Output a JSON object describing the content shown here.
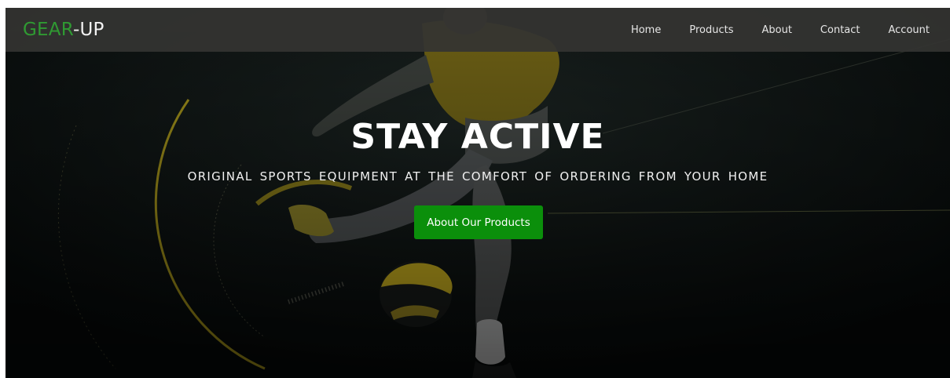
{
  "brand": {
    "part1": "GEAR",
    "part2": "-UP",
    "colors": {
      "accent": "#2f9a32",
      "text": "#f2f2f2"
    }
  },
  "nav": {
    "items": [
      {
        "label": "Home"
      },
      {
        "label": "Products"
      },
      {
        "label": "About"
      },
      {
        "label": "Contact"
      },
      {
        "label": "Account"
      }
    ]
  },
  "hero": {
    "title": "STAY ACTIVE",
    "subtitle": "ORIGINAL SPORTS EQUIPMENT AT THE COMFORT OF ORDERING FROM YOUR HOME",
    "cta_label": "About Our Products",
    "colors": {
      "button": "#0b8f0b",
      "background": "#060a0a",
      "decor_yellow": "#c8b31c"
    }
  }
}
